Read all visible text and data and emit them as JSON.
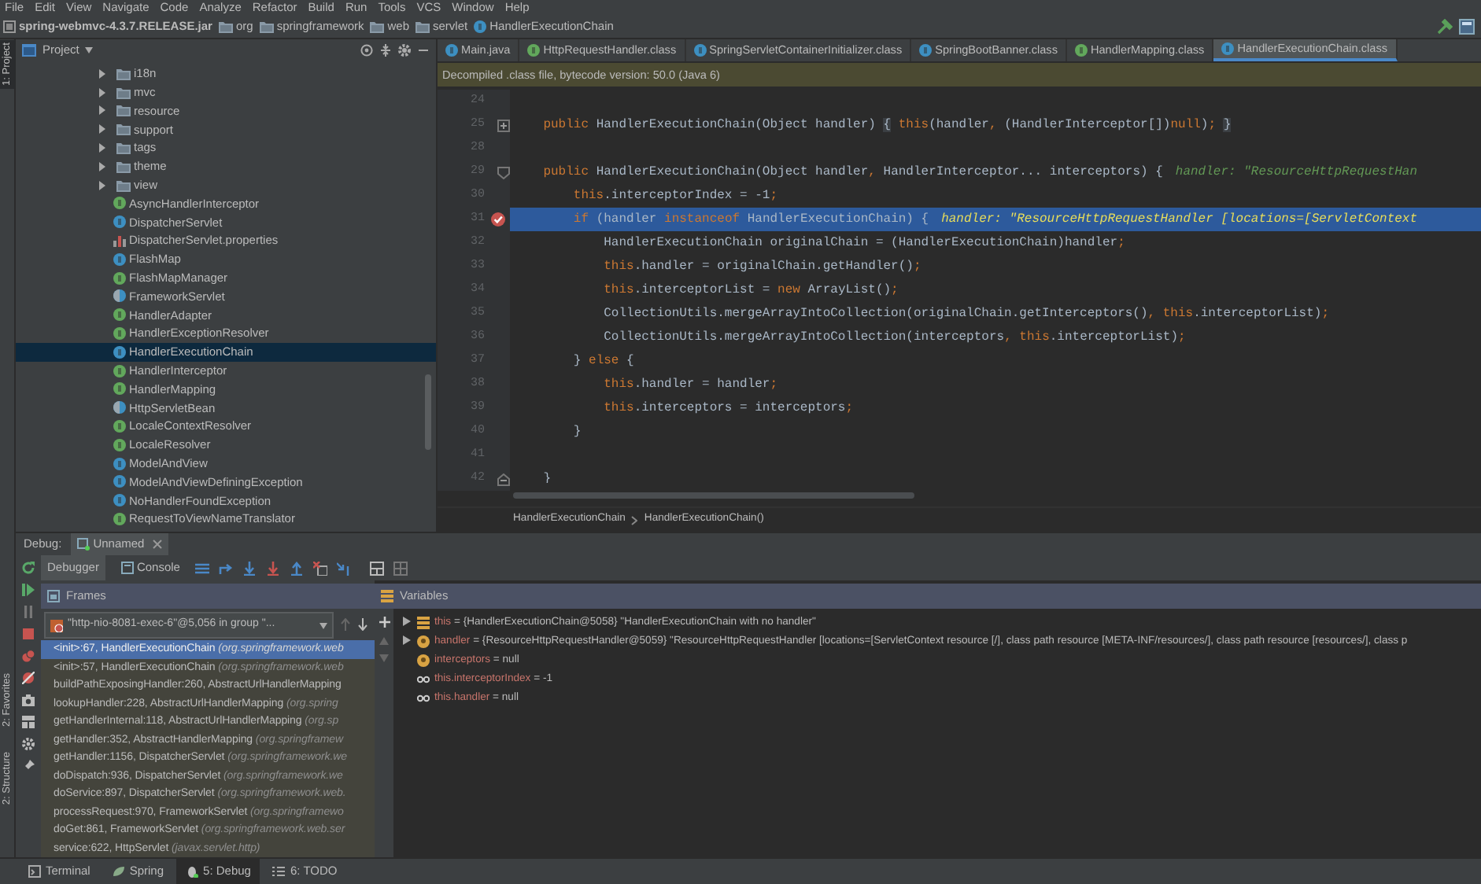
{
  "menu": [
    "File",
    "Edit",
    "View",
    "Navigate",
    "Code",
    "Analyze",
    "Refactor",
    "Build",
    "Run",
    "Tools",
    "VCS",
    "Window",
    "Help"
  ],
  "breadcrumbs": [
    {
      "text": "spring-webmvc-4.3.7.RELEASE.jar",
      "kind": "jar"
    },
    {
      "text": "org",
      "kind": "folder"
    },
    {
      "text": "springframework",
      "kind": "folder"
    },
    {
      "text": "web",
      "kind": "folder"
    },
    {
      "text": "servlet",
      "kind": "folder"
    },
    {
      "text": "HandlerExecutionChain",
      "kind": "class"
    }
  ],
  "tool_stripe": {
    "top": [
      {
        "label": "1: Project",
        "selected": true
      }
    ],
    "bottom": [
      {
        "label": "2: Favorites",
        "selected": false
      },
      {
        "label": "2: Structure",
        "selected": false
      }
    ]
  },
  "project": {
    "title": "Project",
    "items": [
      {
        "label": "i18n",
        "kind": "folder",
        "expanded": false
      },
      {
        "label": "mvc",
        "kind": "folder",
        "expanded": false
      },
      {
        "label": "resource",
        "kind": "folder",
        "expanded": false
      },
      {
        "label": "support",
        "kind": "folder",
        "expanded": false
      },
      {
        "label": "tags",
        "kind": "folder",
        "expanded": false
      },
      {
        "label": "theme",
        "kind": "folder",
        "expanded": false
      },
      {
        "label": "view",
        "kind": "folder",
        "expanded": false
      },
      {
        "label": "AsyncHandlerInterceptor",
        "kind": "interface",
        "selected": false
      },
      {
        "label": "DispatcherServlet",
        "kind": "class",
        "selected": false
      },
      {
        "label": "DispatcherServlet.properties",
        "kind": "properties",
        "selected": false
      },
      {
        "label": "FlashMap",
        "kind": "class",
        "selected": false
      },
      {
        "label": "FlashMapManager",
        "kind": "interface",
        "selected": false
      },
      {
        "label": "FrameworkServlet",
        "kind": "abstract",
        "selected": false
      },
      {
        "label": "HandlerAdapter",
        "kind": "interface",
        "selected": false
      },
      {
        "label": "HandlerExceptionResolver",
        "kind": "interface",
        "selected": false
      },
      {
        "label": "HandlerExecutionChain",
        "kind": "class",
        "selected": true
      },
      {
        "label": "HandlerInterceptor",
        "kind": "interface",
        "selected": false
      },
      {
        "label": "HandlerMapping",
        "kind": "interface",
        "selected": false
      },
      {
        "label": "HttpServletBean",
        "kind": "abstract",
        "selected": false
      },
      {
        "label": "LocaleContextResolver",
        "kind": "interface",
        "selected": false
      },
      {
        "label": "LocaleResolver",
        "kind": "interface",
        "selected": false
      },
      {
        "label": "ModelAndView",
        "kind": "class",
        "selected": false
      },
      {
        "label": "ModelAndViewDefiningException",
        "kind": "class",
        "selected": false
      },
      {
        "label": "NoHandlerFoundException",
        "kind": "class",
        "selected": false
      },
      {
        "label": "RequestToViewNameTranslator",
        "kind": "interface",
        "selected": false
      }
    ]
  },
  "editor": {
    "tabs": [
      {
        "label": "Main.java",
        "kind": "java",
        "selected": false
      },
      {
        "label": "HttpRequestHandler.class",
        "kind": "interface",
        "selected": false
      },
      {
        "label": "SpringServletContainerInitializer.class",
        "kind": "class",
        "selected": false
      },
      {
        "label": "SpringBootBanner.class",
        "kind": "class",
        "selected": false
      },
      {
        "label": "HandlerMapping.class",
        "kind": "interface",
        "selected": false
      },
      {
        "label": "HandlerExecutionChain.class",
        "kind": "class",
        "selected": true
      }
    ],
    "notice": "Decompiled .class file, bytecode version: 50.0 (Java 6)",
    "lines": [
      {
        "number": "24",
        "kind": "plain",
        "selected": false
      },
      {
        "number": "25",
        "kind": "collapsed",
        "selected": false,
        "code": [
          {
            "kind": "keyword",
            "t": "    public"
          },
          {
            "kind": "plain",
            "t": " HandlerExecutionChain(Object handler) "
          },
          {
            "kind": "folded",
            "t": "{"
          },
          {
            "kind": "keyword",
            "t": " this"
          },
          {
            "kind": "plain",
            "t": "(handler"
          },
          {
            "kind": "keyword",
            "t": ","
          },
          {
            "kind": "plain",
            "t": " (HandlerInterceptor[])"
          },
          {
            "kind": "keyword",
            "t": "null"
          },
          {
            "kind": "plain",
            "t": ")"
          },
          {
            "kind": "keyword",
            "t": "; "
          },
          {
            "kind": "folded",
            "t": "}"
          }
        ]
      },
      {
        "number": "28",
        "kind": "plain",
        "selected": false
      },
      {
        "number": "29",
        "kind": "opening",
        "selected": false,
        "hint": "handler: \"ResourceHttpRequestHan",
        "code": [
          {
            "kind": "keyword",
            "t": "    public"
          },
          {
            "kind": "plain",
            "t": " HandlerExecutionChain(Object handler"
          },
          {
            "kind": "keyword",
            "t": ","
          },
          {
            "kind": "plain",
            "t": " HandlerInterceptor... interceptors) {"
          }
        ]
      },
      {
        "number": "30",
        "kind": "plain",
        "selected": false,
        "code": [
          {
            "kind": "keyword",
            "t": "        this"
          },
          {
            "kind": "plain",
            "t": ".interceptorIndex = -1"
          },
          {
            "kind": "keyword",
            "t": ";"
          }
        ]
      },
      {
        "number": "31",
        "kind": "plain",
        "selected": true,
        "breakpoint": true,
        "hint": "handler: \"ResourceHttpRequestHandler [locations=[ServletContext",
        "code": [
          {
            "kind": "keyword",
            "t": "        if"
          },
          {
            "kind": "plain",
            "t": " (handler "
          },
          {
            "kind": "keyword",
            "t": "instanceof"
          },
          {
            "kind": "plain",
            "t": " HandlerExecutionChain) {"
          }
        ]
      },
      {
        "number": "32",
        "kind": "plain",
        "selected": false,
        "code": [
          {
            "kind": "plain",
            "t": "            HandlerExecutionChain originalChain = (HandlerExecutionChain)handler"
          },
          {
            "kind": "keyword",
            "t": ";"
          }
        ]
      },
      {
        "number": "33",
        "kind": "plain",
        "selected": false,
        "code": [
          {
            "kind": "keyword",
            "t": "            this"
          },
          {
            "kind": "plain",
            "t": ".handler = originalChain.getHandler()"
          },
          {
            "kind": "keyword",
            "t": ";"
          }
        ]
      },
      {
        "number": "34",
        "kind": "plain",
        "selected": false,
        "code": [
          {
            "kind": "keyword",
            "t": "            this"
          },
          {
            "kind": "plain",
            "t": ".interceptorList = "
          },
          {
            "kind": "keyword",
            "t": "new"
          },
          {
            "kind": "plain",
            "t": " ArrayList()"
          },
          {
            "kind": "keyword",
            "t": ";"
          }
        ]
      },
      {
        "number": "35",
        "kind": "plain",
        "selected": false,
        "code": [
          {
            "kind": "plain",
            "t": "            CollectionUtils.mergeArrayIntoCollection(originalChain.getInterceptors()"
          },
          {
            "kind": "keyword",
            "t": ", this"
          },
          {
            "kind": "plain",
            "t": ".interceptorList)"
          },
          {
            "kind": "keyword",
            "t": ";"
          }
        ]
      },
      {
        "number": "36",
        "kind": "plain",
        "selected": false,
        "code": [
          {
            "kind": "plain",
            "t": "            CollectionUtils.mergeArrayIntoCollection(interceptors"
          },
          {
            "kind": "keyword",
            "t": ", this"
          },
          {
            "kind": "plain",
            "t": ".interceptorList)"
          },
          {
            "kind": "keyword",
            "t": ";"
          }
        ]
      },
      {
        "number": "37",
        "kind": "plain",
        "selected": false,
        "code": [
          {
            "kind": "plain",
            "t": "        } "
          },
          {
            "kind": "keyword",
            "t": "else"
          },
          {
            "kind": "plain",
            "t": " {"
          }
        ]
      },
      {
        "number": "38",
        "kind": "plain",
        "selected": false,
        "code": [
          {
            "kind": "keyword",
            "t": "            this"
          },
          {
            "kind": "plain",
            "t": ".handler = handler"
          },
          {
            "kind": "keyword",
            "t": ";"
          }
        ]
      },
      {
        "number": "39",
        "kind": "plain",
        "selected": false,
        "code": [
          {
            "kind": "keyword",
            "t": "            this"
          },
          {
            "kind": "plain",
            "t": ".interceptors = interceptors"
          },
          {
            "kind": "keyword",
            "t": ";"
          }
        ]
      },
      {
        "number": "40",
        "kind": "plain",
        "selected": false,
        "code": [
          {
            "kind": "plain",
            "t": "        }"
          }
        ]
      },
      {
        "number": "41",
        "kind": "plain",
        "selected": false
      },
      {
        "number": "42",
        "kind": "closing",
        "selected": false,
        "code": [
          {
            "kind": "plain",
            "t": "    }"
          }
        ]
      }
    ],
    "path": [
      "HandlerExecutionChain",
      "HandlerExecutionChain()"
    ]
  },
  "debug": {
    "label": "Debug:",
    "session": "Unnamed",
    "tabs": [
      {
        "label": "Debugger",
        "selected": true
      },
      {
        "label": "Console",
        "selected": false
      }
    ],
    "frames": {
      "title": "Frames",
      "thread": "\"http-nio-8081-exec-6\"@5,056 in group \"...",
      "items": [
        {
          "text": "<init>:67, HandlerExecutionChain *(org.springframework.web*",
          "selected": true
        },
        {
          "text": "<init>:57, HandlerExecutionChain *(org.springframework.web*",
          "selected": false
        },
        {
          "text": "buildPathExposingHandler:260, AbstractUrlHandlerMapping",
          "selected": false
        },
        {
          "text": "lookupHandler:228, AbstractUrlHandlerMapping *(org.spring*",
          "selected": false
        },
        {
          "text": "getHandlerInternal:118, AbstractUrlHandlerMapping *(org.sp*",
          "selected": false
        },
        {
          "text": "getHandler:352, AbstractHandlerMapping *(org.springframew*",
          "selected": false
        },
        {
          "text": "getHandler:1156, DispatcherServlet *(org.springframework.we*",
          "selected": false
        },
        {
          "text": "doDispatch:936, DispatcherServlet *(org.springframework.we*",
          "selected": false
        },
        {
          "text": "doService:897, DispatcherServlet *(org.springframework.web.*",
          "selected": false
        },
        {
          "text": "processRequest:970, FrameworkServlet *(org.springframewo*",
          "selected": false
        },
        {
          "text": "doGet:861, FrameworkServlet *(org.springframework.web.ser*",
          "selected": false
        },
        {
          "text": "service:622, HttpServlet *(javax.servlet.http)*",
          "selected": false
        }
      ]
    },
    "variables": {
      "title": "Variables",
      "items": [
        {
          "kind": "object",
          "expanded": false,
          "name": "this",
          "value": "= {HandlerExecutionChain@5058} \"HandlerExecutionChain with no handler\""
        },
        {
          "kind": "parameter",
          "expanded": false,
          "name": "handler",
          "value": "= {ResourceHttpRequestHandler@5059} \"ResourceHttpRequestHandler [locations=[ServletContext resource [/], class path resource [META-INF/resources/], class path resource [resources/], class p"
        },
        {
          "kind": "parameter",
          "name": "interceptors",
          "value": "= null"
        },
        {
          "kind": "watch",
          "name": "this.interceptorIndex",
          "value": "= -1"
        },
        {
          "kind": "watch",
          "name": "this.handler",
          "value": "= null"
        }
      ]
    }
  },
  "bottom_tabs": [
    {
      "label": "Terminal",
      "kind": "terminal",
      "selected": false
    },
    {
      "label": "Spring",
      "kind": "spring",
      "selected": false
    },
    {
      "label": "5: Debug",
      "kind": "debug",
      "selected": true
    },
    {
      "label": "6: TODO",
      "kind": "todo",
      "selected": false
    }
  ]
}
